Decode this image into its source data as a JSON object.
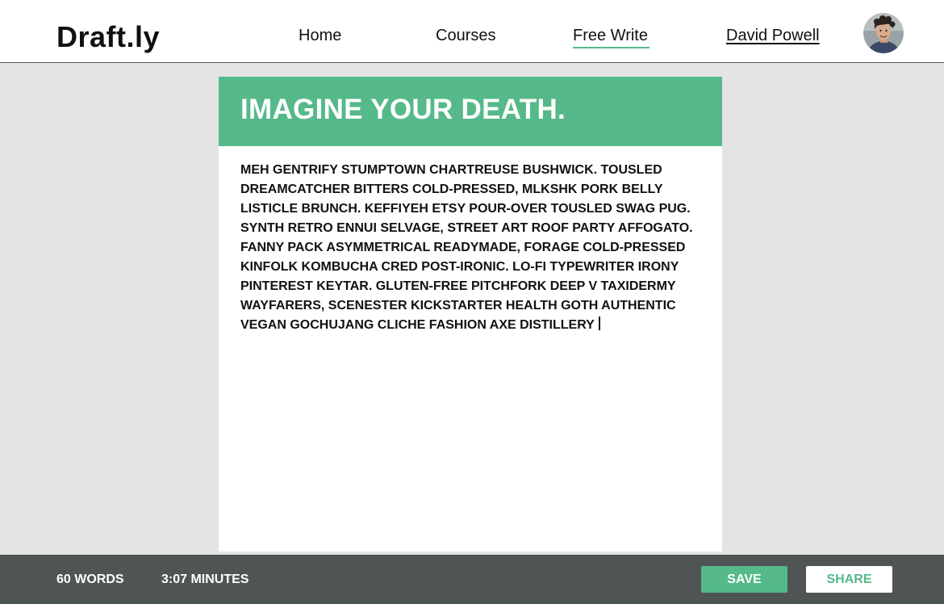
{
  "app": {
    "name": "Draft.ly"
  },
  "nav": {
    "home": "Home",
    "courses": "Courses",
    "free_write": "Free Write",
    "user": "David Powell",
    "active": "Free Write"
  },
  "prompt": {
    "title": "IMAGINE YOUR DEATH."
  },
  "editor": {
    "text": "MEH GENTRIFY STUMPTOWN CHARTREUSE BUSHWICK. TOUSLED DREAMCATCHER BITTERS COLD-PRESSED, MLKSHK PORK BELLY LISTICLE BRUNCH. KEFFIYEH ETSY POUR-OVER TOUSLED SWAG PUG. SYNTH RETRO ENNUI SELVAGE, STREET ART ROOF PARTY AFFOGATO. FANNY PACK ASYMMETRICAL READYMADE, FORAGE COLD-PRESSED KINFOLK KOMBUCHA CRED POST-IRONIC. LO-FI TYPEWRITER IRONY PINTEREST KEYTAR. GLUTEN-FREE PITCHFORK DEEP V TAXIDERMY WAYFARERS, SCENESTER KICKSTARTER HEALTH GOTH AUTHENTIC VEGAN GOCHUJANG CLICHE FASHION AXE DISTILLERY"
  },
  "footer": {
    "word_count": "60 WORDS",
    "elapsed": "3:07 MINUTES",
    "save_label": "SAVE",
    "share_label": "SHARE"
  },
  "colors": {
    "accent": "#55b98a",
    "footer_bg": "#4f5555",
    "page_bg": "#e4e4e4"
  },
  "icons": {
    "avatar": "user-avatar-photo"
  }
}
